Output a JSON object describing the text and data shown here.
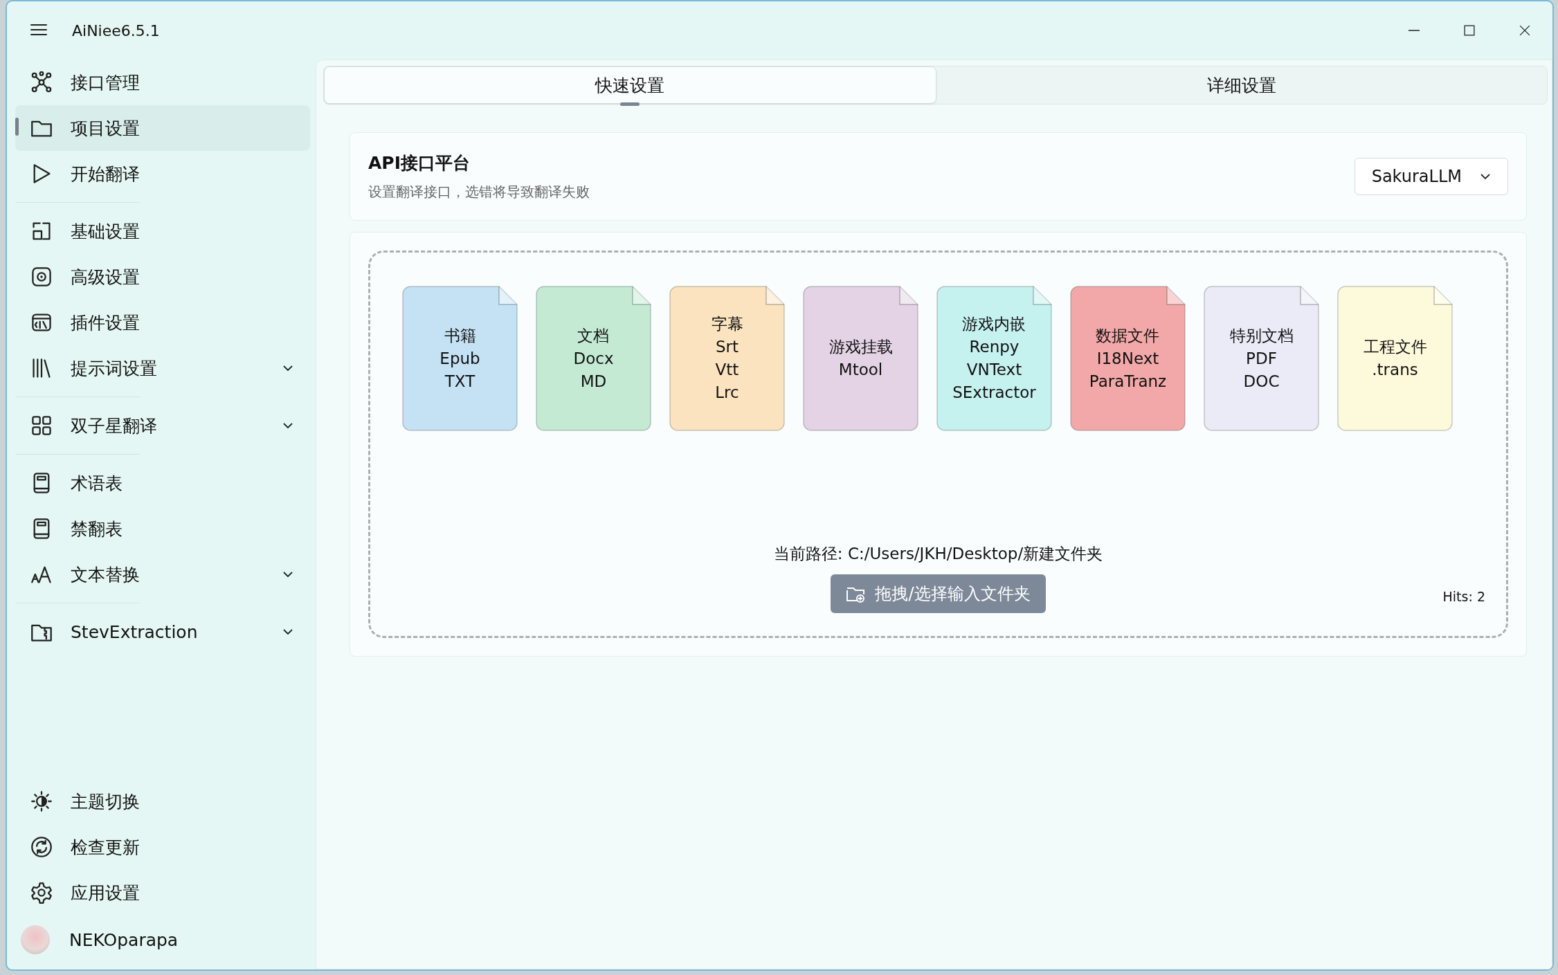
{
  "window": {
    "title": "AiNiee6.5.1"
  },
  "sidebar": {
    "groups": [
      [
        {
          "label": "接口管理",
          "selected": false,
          "expandable": false
        },
        {
          "label": "项目设置",
          "selected": true,
          "expandable": false
        },
        {
          "label": "开始翻译",
          "selected": false,
          "expandable": false
        }
      ],
      [
        {
          "label": "基础设置",
          "selected": false,
          "expandable": false
        },
        {
          "label": "高级设置",
          "selected": false,
          "expandable": false
        },
        {
          "label": "插件设置",
          "selected": false,
          "expandable": false
        },
        {
          "label": "提示词设置",
          "selected": false,
          "expandable": true
        }
      ],
      [
        {
          "label": "双子星翻译",
          "selected": false,
          "expandable": true
        }
      ],
      [
        {
          "label": "术语表",
          "selected": false,
          "expandable": false
        },
        {
          "label": "禁翻表",
          "selected": false,
          "expandable": false
        },
        {
          "label": "文本替换",
          "selected": false,
          "expandable": true
        }
      ],
      [
        {
          "label": "StevExtraction",
          "selected": false,
          "expandable": true
        }
      ]
    ],
    "bottom_items": [
      {
        "label": "主题切换"
      },
      {
        "label": "检查更新"
      },
      {
        "label": "应用设置"
      }
    ],
    "user": {
      "name": "NEKOparapa"
    }
  },
  "tabs": [
    {
      "label": "快速设置",
      "selected": true
    },
    {
      "label": "详细设置",
      "selected": false
    }
  ],
  "api_platform": {
    "title": "API接口平台",
    "description": "设置翻译接口，选错将导致翻译失败",
    "dropdown": {
      "value": "SakuraLLM"
    }
  },
  "file_types": [
    {
      "lines": [
        "书籍",
        "Epub",
        "TXT"
      ],
      "color": "#c5e2f5"
    },
    {
      "lines": [
        "文档",
        "Docx",
        "MD"
      ],
      "color": "#c4ead4"
    },
    {
      "lines": [
        "字幕",
        "Srt",
        "Vtt",
        "Lrc"
      ],
      "color": "#fbe3bf"
    },
    {
      "lines": [
        "游戏挂载",
        "Mtool"
      ],
      "color": "#e3d3e5"
    },
    {
      "lines": [
        "游戏内嵌",
        "Renpy",
        "VNText",
        "SExtractor"
      ],
      "color": "#c5f1ef"
    },
    {
      "lines": [
        "数据文件",
        "I18Next",
        "ParaTranz"
      ],
      "color": "#f2a8a8"
    },
    {
      "lines": [
        "特别文档",
        "PDF",
        "DOC"
      ],
      "color": "#ebebf8"
    },
    {
      "lines": [
        "工程文件",
        ".trans"
      ],
      "color": "#fdfadc"
    }
  ],
  "current_path": "当前路径: C:/Users/JKH/Desktop/新建文件夹",
  "select_button": "拖拽/选择输入文件夹",
  "hits": "Hits: 2"
}
